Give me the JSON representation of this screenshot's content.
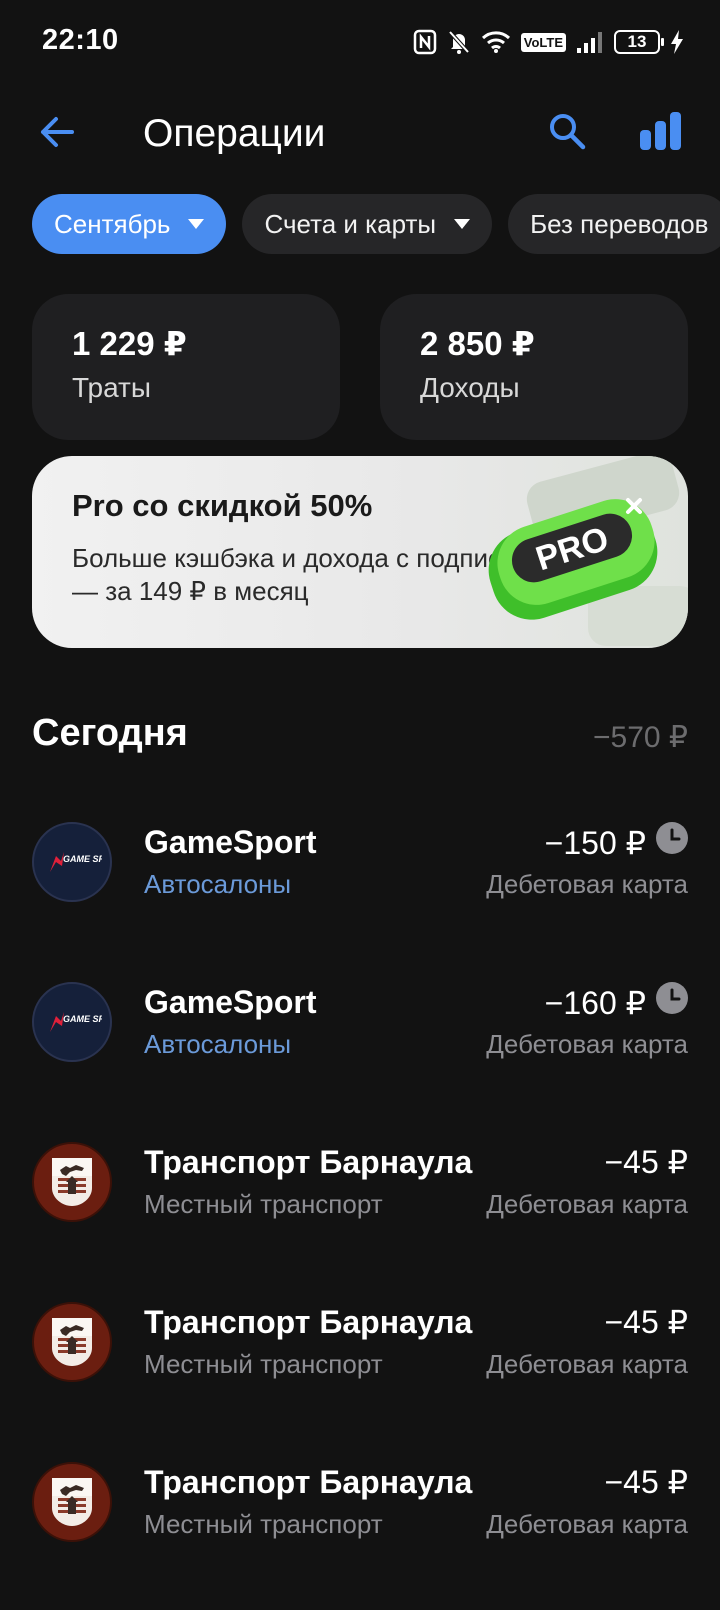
{
  "status_bar": {
    "time": "22:10",
    "network": "VoLTE",
    "battery": "13",
    "icons": [
      "nfc-icon",
      "bell-off-icon",
      "wifi-icon",
      "signal-icon",
      "battery-icon",
      "charging-icon"
    ]
  },
  "header": {
    "title": "Операции",
    "icons": {
      "back": "arrow-left-icon",
      "search": "search-icon",
      "stats": "bar-chart-icon"
    },
    "accent_color": "#4a8ef2"
  },
  "filters": [
    {
      "label": "Сентябрь",
      "active": true
    },
    {
      "label": "Счета и карты",
      "active": false
    },
    {
      "label": "Без переводов",
      "active": false
    }
  ],
  "summary": {
    "spend": {
      "amount": "1 229 ₽",
      "label": "Траты"
    },
    "income": {
      "amount": "2 850 ₽",
      "label": "Доходы"
    }
  },
  "promo": {
    "title": "Pro со скидкой 50%",
    "text": "Больше кэшбэка и дохода с подпиской — за 149 ₽ в месяц",
    "badge": "PRO"
  },
  "section": {
    "title": "Сегодня",
    "total": "−570 ₽"
  },
  "operations": [
    {
      "name": "GameSport",
      "category": "Автосалоны",
      "amount": "−150 ₽",
      "source": "Дебетовая карта",
      "pending": true,
      "logo": "gamesport-logo",
      "logo_text": "GAME SPORT"
    },
    {
      "name": "GameSport",
      "category": "Автосалоны",
      "amount": "−160 ₽",
      "source": "Дебетовая карта",
      "pending": true,
      "logo": "gamesport-logo",
      "logo_text": "GAME SPORT"
    },
    {
      "name": "Транспорт Барнаула",
      "category": "Местный транспорт",
      "amount": "−45 ₽",
      "source": "Дебетовая карта",
      "pending": false,
      "logo": "barnaul-coat-of-arms"
    },
    {
      "name": "Транспорт Барнаула",
      "category": "Местный транспорт",
      "amount": "−45 ₽",
      "source": "Дебетовая карта",
      "pending": false,
      "logo": "barnaul-coat-of-arms"
    },
    {
      "name": "Транспорт Барнаула",
      "category": "Местный транспорт",
      "amount": "−45 ₽",
      "source": "Дебетовая карта",
      "pending": false,
      "logo": "barnaul-coat-of-arms"
    }
  ]
}
